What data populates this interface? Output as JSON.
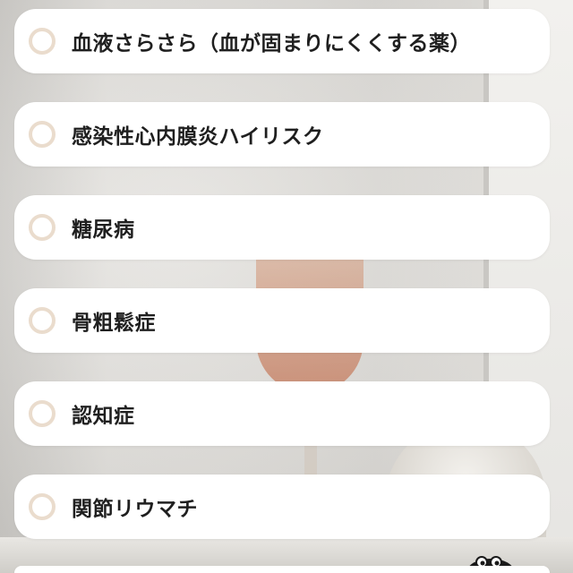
{
  "options": [
    {
      "label": "血液さらさら（血が固まりにくくする薬）"
    },
    {
      "label": "感染性心内膜炎ハイリスク"
    },
    {
      "label": "糖尿病"
    },
    {
      "label": "骨粗鬆症"
    },
    {
      "label": "認知症"
    },
    {
      "label": "関節リウマチ"
    }
  ],
  "colors": {
    "card": "#ffffff",
    "radio_ring": "#eadccd",
    "text": "#1f1f1f"
  }
}
